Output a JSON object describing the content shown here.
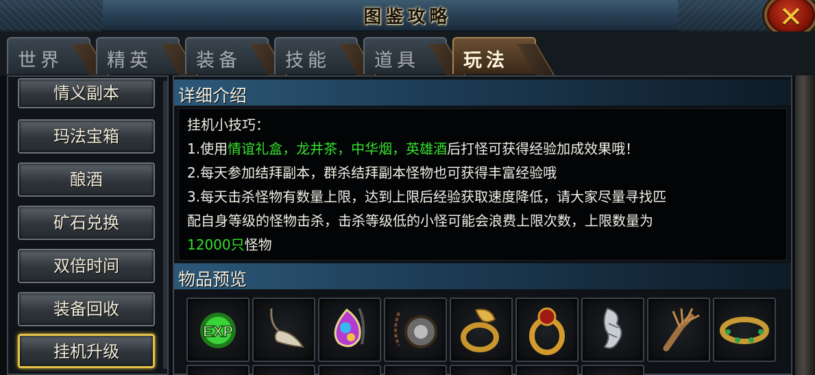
{
  "window": {
    "title": "图鉴攻略",
    "close_label": "✕"
  },
  "tabs": [
    "世界",
    "精英",
    "装备",
    "技能",
    "道具",
    "玩法"
  ],
  "active_tab": "玩法",
  "sidebar": {
    "items": [
      "情义副本",
      "玛法宝箱",
      "酿酒",
      "矿石兑换",
      "双倍时间",
      "装备回收",
      "挂机升级"
    ],
    "active_item": "挂机升级"
  },
  "detail": {
    "heading": "详细介绍",
    "line0": "挂机小技巧：",
    "line1_a": "1.使用",
    "line1_green": "情谊礼盒，龙井茶，中华烟，英雄酒",
    "line1_b": "后打怪可获得经验加成效果哦！",
    "line2": "2.每天参加结拜副本，群杀结拜副本怪物也可获得丰富经验哦",
    "line3": "3.每天击杀怪物有数量上限，达到上限后经验获取速度降低，请大家尽量寻找匹",
    "line4": "配自身等级的怪物击杀，击杀等级低的小怪可能会浪费上限次数，上限数量为",
    "line5_green": "12000只",
    "line5_b": "怪物"
  },
  "preview": {
    "heading": "物品预览",
    "items": [
      {
        "icon": "exp-orb-icon",
        "text": "EXP"
      },
      {
        "icon": "claw-pendant-icon"
      },
      {
        "icon": "gem-amulet-icon"
      },
      {
        "icon": "stone-necklace-icon"
      },
      {
        "icon": "dragon-ring-icon"
      },
      {
        "icon": "ruby-ring-icon"
      },
      {
        "icon": "silver-bracer-icon"
      },
      {
        "icon": "bone-gauntlet-icon"
      },
      {
        "icon": "emerald-bracelet-icon"
      }
    ]
  },
  "colors": {
    "highlight_green": "#35e02e",
    "active_border": "#e3c348",
    "section_blue": "#2c5878"
  }
}
